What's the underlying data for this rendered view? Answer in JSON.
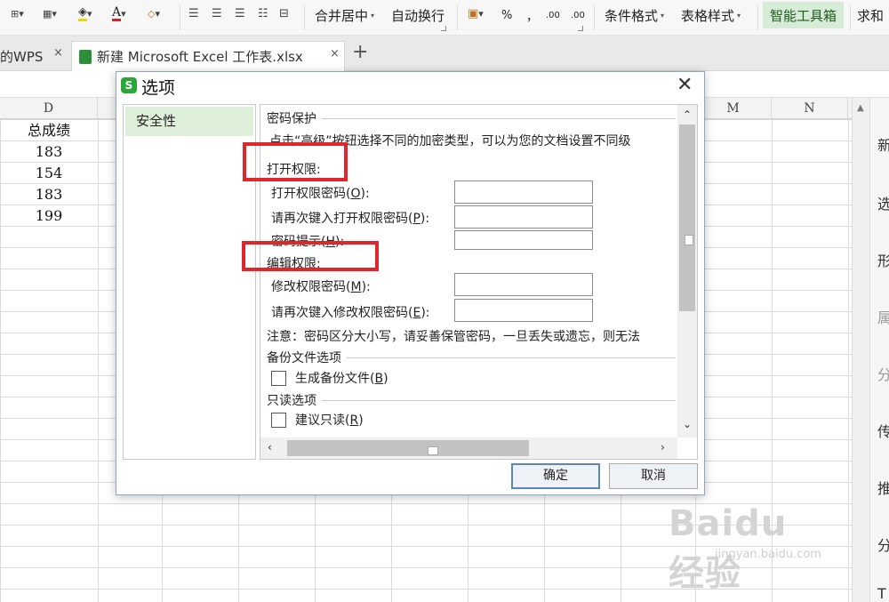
{
  "ribbon": {
    "merge_center": "合并居中",
    "wrap_text": "自动换行",
    "percent": "%",
    "thousands": "，",
    "dec_inc": ".00",
    "dec_dec": ".00",
    "conditional_format": "条件格式",
    "table_style": "表格样式",
    "smart_toolbox": "智能工具箱",
    "sum": "求和"
  },
  "tabs": {
    "wps_tab": "的WPS",
    "excel_tab": "新建 Microsoft Excel 工作表.xlsx",
    "close": "×",
    "new_tab": "+"
  },
  "sheet": {
    "col_d": "D",
    "col_m": "M",
    "col_n": "N",
    "cells": [
      "总成绩",
      "183",
      "154",
      "183",
      "199"
    ]
  },
  "taskpane": [
    "新",
    "选",
    "形",
    "属",
    "分",
    "传",
    "推",
    "分",
    "T"
  ],
  "dialog": {
    "logo": "S",
    "title": "选项",
    "close": "✕",
    "sidebar_item": "安全性",
    "password_protect": "密码保护",
    "intro": "点击“高级”按钮选择不同的加密类型，可以为您的文档设置不同级",
    "open_perm": "打开权限:",
    "open_pwd_label": "打开权限密码",
    "open_pwd_key": "O",
    "open_pwd_confirm_label": "请再次键入打开权限密码",
    "open_pwd_confirm_key": "P",
    "pwd_hint_label": "密码提示",
    "pwd_hint_key": "H",
    "edit_perm": "编辑权限:",
    "edit_pwd_label": "修改权限密码",
    "edit_pwd_key": "M",
    "edit_pwd_confirm_label": "请再次键入修改权限密码",
    "edit_pwd_confirm_key": "E",
    "note": "注意：密码区分大小写，请妥善保管密码，一旦丢失或遗忘，则无法",
    "backup_section": "备份文件选项",
    "backup_checkbox": "生成备份文件",
    "backup_key": "B",
    "readonly_section": "只读选项",
    "readonly_checkbox": "建议只读",
    "readonly_key": "R",
    "ok": "确定",
    "cancel": "取消"
  },
  "watermark": {
    "logo": "Baidu经验",
    "url": "jingyan.baidu.com"
  },
  "colors": {
    "accent_green": "#2aa63b",
    "selected_item_bg": "#dff0da",
    "highlight_red": "#e0262b"
  }
}
